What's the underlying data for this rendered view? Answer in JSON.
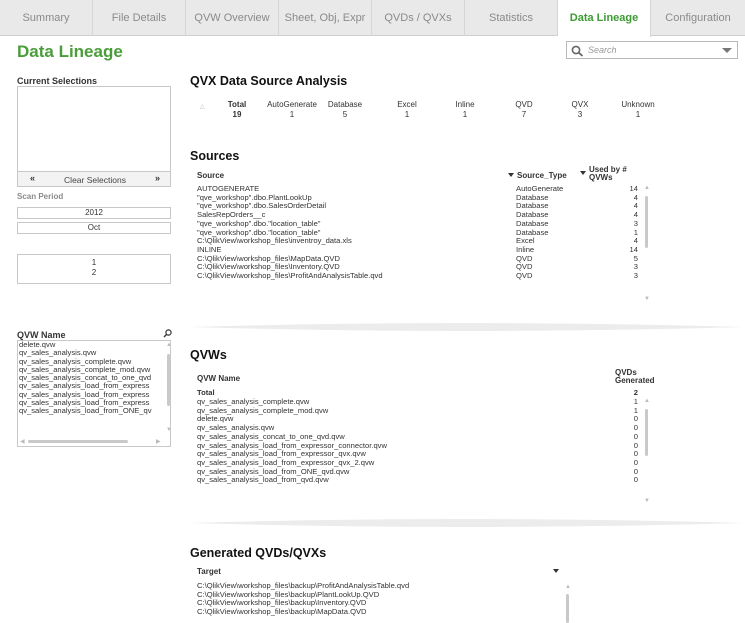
{
  "tabs": [
    {
      "label": "Summary",
      "active": false
    },
    {
      "label": "File Details",
      "active": false
    },
    {
      "label": "QVW Overview",
      "active": false
    },
    {
      "label": "Sheet, Obj, Expr",
      "active": false
    },
    {
      "label": "QVDs / QVXs",
      "active": false
    },
    {
      "label": "Statistics",
      "active": false
    },
    {
      "label": "Data Lineage",
      "active": true
    },
    {
      "label": "Configuration",
      "active": false
    }
  ],
  "page": {
    "title": "Data Lineage"
  },
  "search": {
    "placeholder": "Search",
    "icon": "magnifier-icon"
  },
  "left_panel": {
    "current_selections_label": "Current Selections",
    "clear_selections_label": "Clear Selections",
    "prev_glyph": "«",
    "next_glyph": "»",
    "scan_period_label": "Scan Period",
    "years": [
      "2012"
    ],
    "months": [
      "Oct"
    ],
    "days": [
      "1",
      "2"
    ],
    "qvw_name_label": "QVW Name",
    "qvw_names": [
      "delete.qvw",
      "qv_sales_analysis.qvw",
      "qv_sales_analysis_complete.qvw",
      "qv_sales_analysis_complete_mod.qvw",
      "qv_sales_analysis_concat_to_one_qvd",
      "qv_sales_analysis_load_from_express",
      "qv_sales_analysis_load_from_express",
      "qv_sales_analysis_load_from_express",
      "qv_sales_analysis_load_from_ONE_qv"
    ]
  },
  "qvx_analysis": {
    "title": "QVX Data Source Analysis",
    "columns": [
      "Total",
      "AutoGenerate",
      "Database",
      "Excel",
      "Inline",
      "QVD",
      "QVX",
      "Unknown"
    ],
    "values": [
      "19",
      "1",
      "5",
      "1",
      "1",
      "7",
      "3",
      "1"
    ]
  },
  "sources": {
    "title": "Sources",
    "headers": {
      "source": "Source",
      "source_type": "Source_Type",
      "used_by": "Used by # QVWs"
    },
    "rows": [
      {
        "source": "AUTOGENERATE",
        "type": "AutoGenerate",
        "used": "14"
      },
      {
        "source": "\"qve_workshop\".dbo.PlantLookUp",
        "type": "Database",
        "used": "4"
      },
      {
        "source": "\"qve_workshop\".dbo.SalesOrderDetail",
        "type": "Database",
        "used": "4"
      },
      {
        "source": "SalesRepOrders__c",
        "type": "Database",
        "used": "4"
      },
      {
        "source": "\"qve_workshop\".dbo.\"location_table\"",
        "type": "Database",
        "used": "3"
      },
      {
        "source": "\"qve_workshop\".dbo.\"location_table\"",
        "type": "Database",
        "used": "1"
      },
      {
        "source": "C:\\QlikView\\workshop_files\\inventroy_data.xls",
        "type": "Excel",
        "used": "4"
      },
      {
        "source": "INLINE",
        "type": "Inline",
        "used": "14"
      },
      {
        "source": "C:\\QlikView\\workshop_files\\MapData.QVD",
        "type": "QVD",
        "used": "5"
      },
      {
        "source": "C:\\QlikView\\workshop_files\\Inventory.QVD",
        "type": "QVD",
        "used": "3"
      },
      {
        "source": "C:\\QlikView\\workshop_files\\ProfitAndAnalysisTable.qvd",
        "type": "QVD",
        "used": "3"
      }
    ]
  },
  "qvws": {
    "title": "QVWs",
    "headers": {
      "name": "QVW Name",
      "generated": "QVDs Generated"
    },
    "total_label": "Total",
    "total_value": "2",
    "rows": [
      {
        "name": "qv_sales_analysis_complete.qvw",
        "value": "1"
      },
      {
        "name": "qv_sales_analysis_complete_mod.qvw",
        "value": "1"
      },
      {
        "name": "delete.qvw",
        "value": "0"
      },
      {
        "name": "qv_sales_analysis.qvw",
        "value": "0"
      },
      {
        "name": "qv_sales_analysis_concat_to_one_qvd.qvw",
        "value": "0"
      },
      {
        "name": "qv_sales_analysis_load_from_expressor_connector.qvw",
        "value": "0"
      },
      {
        "name": "qv_sales_analysis_load_from_expressor_qvx.qvw",
        "value": "0"
      },
      {
        "name": "qv_sales_analysis_load_from_expressor_qvx_2.qvw",
        "value": "0"
      },
      {
        "name": "qv_sales_analysis_load_from_ONE_qvd.qvw",
        "value": "0"
      },
      {
        "name": "qv_sales_analysis_load_from_qvd.qvw",
        "value": "0"
      }
    ]
  },
  "generated": {
    "title": "Generated QVDs/QVXs",
    "header": "Target",
    "rows": [
      "C:\\QlikView\\workshop_files\\backup\\ProfitAndAnalysisTable.qvd",
      "C:\\QlikView\\workshop_files\\backup\\PlantLookUp.QVD",
      "C:\\QlikView\\workshop_files\\backup\\Inventory.QVD",
      "C:\\QlikView\\workshop_files\\backup\\MapData.QVD"
    ]
  },
  "colors": {
    "accent": "#4a9e3a",
    "tab_bg": "#e9e9e9"
  }
}
